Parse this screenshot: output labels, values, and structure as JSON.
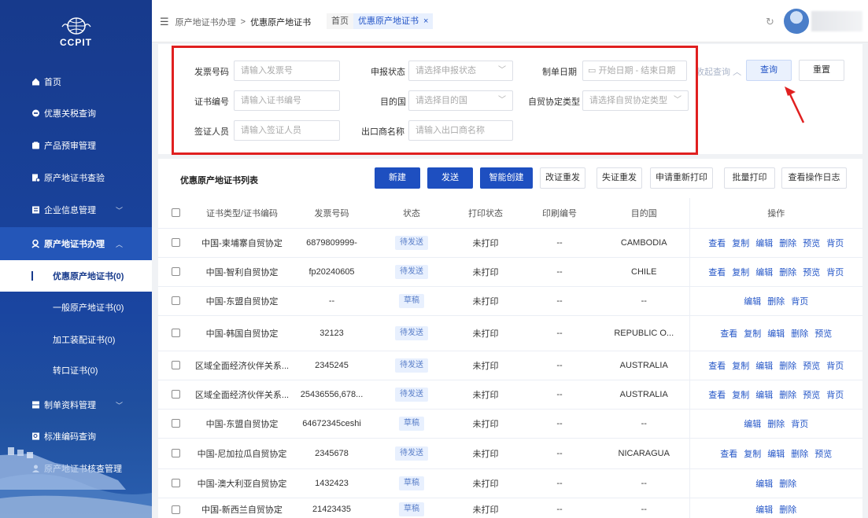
{
  "logo": {
    "text": "CCPIT"
  },
  "sidebar": {
    "items": [
      {
        "label": "首页",
        "icon": "home-icon"
      },
      {
        "label": "优惠关税查询",
        "icon": "search-icon"
      },
      {
        "label": "产品预审管理",
        "icon": "folder-icon"
      },
      {
        "label": "原产地证书查验",
        "icon": "file-check-icon"
      },
      {
        "label": "企业信息管理",
        "icon": "building-icon"
      },
      {
        "label": "原产地证书办理",
        "icon": "user-cert-icon"
      },
      {
        "label": "制单资料管理",
        "icon": "document-icon"
      },
      {
        "label": "标准编码查询",
        "icon": "code-icon"
      },
      {
        "label": "原产地证书核查管理",
        "icon": "user-icon"
      }
    ],
    "subitems": [
      {
        "label": "优惠原产地证书(0)"
      },
      {
        "label": "一般原产地证书(0)"
      },
      {
        "label": "加工装配证书(0)"
      },
      {
        "label": "转口证书(0)"
      }
    ]
  },
  "topbar": {
    "breadcrumb_parent": "原产地证书办理",
    "breadcrumb_sep": ">",
    "breadcrumb_current": "优惠原产地证书",
    "tab_home": "首页",
    "tab_current": "优惠原产地证书",
    "tab_close": "×",
    "refresh": "↻"
  },
  "search": {
    "invoice_label": "发票号码",
    "invoice_placeholder": "请输入发票号",
    "status_label": "申报状态",
    "status_placeholder": "请选择申报状态",
    "date_label": "制单日期",
    "date_start": "开始日期",
    "date_sep": "-",
    "date_end": "结束日期",
    "collapse": "收起查询",
    "query_btn": "查询",
    "reset_btn": "重置",
    "cert_label": "证书编号",
    "cert_placeholder": "请输入证书编号",
    "dest_label": "目的国",
    "dest_placeholder": "请选择目的国",
    "fta_label": "自贸协定类型",
    "fta_placeholder": "请选择自贸协定类型",
    "signer_label": "签证人员",
    "signer_placeholder": "请输入签证人员",
    "exporter_label": "出口商名称",
    "exporter_placeholder": "请输入出口商名称"
  },
  "list": {
    "title": "优惠原产地证书列表",
    "buttons": {
      "new": "新建",
      "send": "发送",
      "smart": "智能创建",
      "reissue": "改证重发",
      "lost": "失证重发",
      "reprint": "申请重新打印",
      "batch_print": "批量打印",
      "log": "查看操作日志"
    },
    "columns": [
      "证书类型/证书编码",
      "发票号码",
      "状态",
      "打印状态",
      "印刷编号",
      "目的国",
      "操作"
    ],
    "rows": [
      {
        "type": "中国-柬埔寨自贸协定",
        "invoice": "6879809999-",
        "status": "待发送",
        "print": "未打印",
        "printno": "--",
        "dest": "CAMBODIA",
        "ops": [
          "查看",
          "复制",
          "编辑",
          "删除",
          "预览",
          "背页"
        ]
      },
      {
        "type": "中国-智利自贸协定",
        "invoice": "fp20240605",
        "status": "待发送",
        "print": "未打印",
        "printno": "--",
        "dest": "CHILE",
        "ops": [
          "查看",
          "复制",
          "编辑",
          "删除",
          "预览",
          "背页"
        ]
      },
      {
        "type": "中国-东盟自贸协定",
        "invoice": "--",
        "status": "草稿",
        "print": "未打印",
        "printno": "--",
        "dest": "--",
        "ops": [
          "编辑",
          "删除",
          "背页"
        ]
      },
      {
        "type": "中国-韩国自贸协定",
        "invoice": "32123",
        "status": "待发送",
        "print": "未打印",
        "printno": "--",
        "dest": "REPUBLIC O...",
        "ops": [
          "查看",
          "复制",
          "编辑",
          "删除",
          "预览"
        ]
      },
      {
        "type": "区域全面经济伙伴关系...",
        "invoice": "2345245",
        "status": "待发送",
        "print": "未打印",
        "printno": "--",
        "dest": "AUSTRALIA",
        "ops": [
          "查看",
          "复制",
          "编辑",
          "删除",
          "预览",
          "背页"
        ]
      },
      {
        "type": "区域全面经济伙伴关系...",
        "invoice": "25436556,678...",
        "status": "待发送",
        "print": "未打印",
        "printno": "--",
        "dest": "AUSTRALIA",
        "ops": [
          "查看",
          "复制",
          "编辑",
          "删除",
          "预览",
          "背页"
        ]
      },
      {
        "type": "中国-东盟自贸协定",
        "invoice": "64672345ceshi",
        "status": "草稿",
        "print": "未打印",
        "printno": "--",
        "dest": "--",
        "ops": [
          "编辑",
          "删除",
          "背页"
        ]
      },
      {
        "type": "中国-尼加拉瓜自贸协定",
        "invoice": "2345678",
        "status": "待发送",
        "print": "未打印",
        "printno": "--",
        "dest": "NICARAGUA",
        "ops": [
          "查看",
          "复制",
          "编辑",
          "删除",
          "预览"
        ]
      },
      {
        "type": "中国-澳大利亚自贸协定",
        "invoice": "1432423",
        "status": "草稿",
        "print": "未打印",
        "printno": "--",
        "dest": "--",
        "ops": [
          "编辑",
          "删除"
        ]
      },
      {
        "type": "中国-新西兰自贸协定",
        "invoice": "21423435",
        "status": "草稿",
        "print": "未打印",
        "printno": "--",
        "dest": "--",
        "ops": [
          "编辑",
          "删除"
        ]
      }
    ]
  },
  "colors": {
    "sidebar": "#173a8c",
    "primary": "#1e4fc0",
    "link": "#2355c7",
    "highlight_box": "#e02020"
  }
}
